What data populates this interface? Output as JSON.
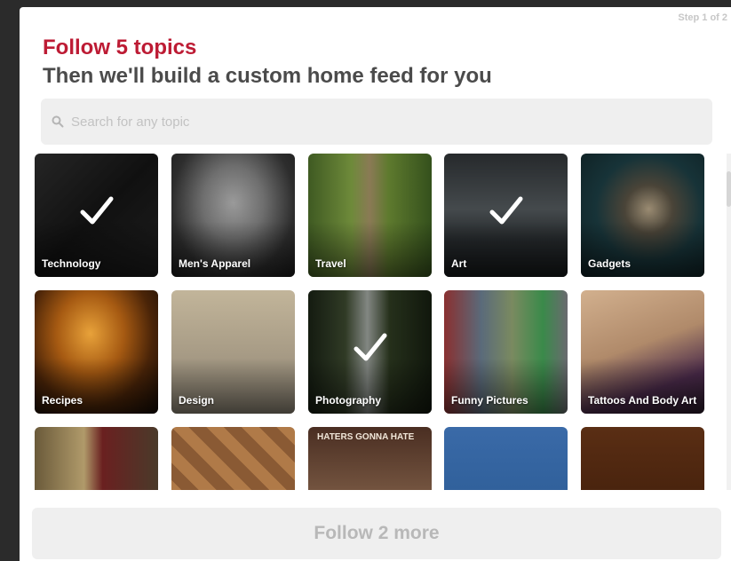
{
  "modal": {
    "step_indicator": "Step 1 of 2",
    "title": "Follow 5 topics",
    "subtitle": "Then we'll build a custom home feed for you"
  },
  "search": {
    "placeholder": "Search for any topic",
    "icon": "search-icon"
  },
  "topics": [
    {
      "label": "Technology",
      "selected": true,
      "color": "#1f1f1f"
    },
    {
      "label": "Men's Apparel",
      "selected": false,
      "color": "#5a5a5a"
    },
    {
      "label": "Travel",
      "selected": false,
      "color": "#4e6b2f"
    },
    {
      "label": "Art",
      "selected": true,
      "color": "#4a5054"
    },
    {
      "label": "Gadgets",
      "selected": false,
      "color": "#1d3a40"
    },
    {
      "label": "Recipes",
      "selected": false,
      "color": "#5a2e0e"
    },
    {
      "label": "Design",
      "selected": false,
      "color": "#a49a86"
    },
    {
      "label": "Photography",
      "selected": true,
      "color": "#2f3b2a"
    },
    {
      "label": "Funny Pictures",
      "selected": false,
      "color": "#6b6f79"
    },
    {
      "label": "Tattoos And Body Art",
      "selected": false,
      "color": "#b08a6a"
    },
    {
      "label": "",
      "selected": false,
      "color": "#6b4a2a"
    },
    {
      "label": "",
      "selected": false,
      "color": "#8a5a34"
    },
    {
      "label": "",
      "selected": false,
      "color": "#5a3a2a",
      "overlay_text": "HATERS GONNA HATE"
    },
    {
      "label": "",
      "selected": false,
      "color": "#2f5f99"
    },
    {
      "label": "",
      "selected": false,
      "color": "#4a2410"
    }
  ],
  "footer": {
    "follow_button_label": "Follow 2 more"
  },
  "colors": {
    "accent_red": "#bd1b34",
    "subtitle_gray": "#4b4b4b",
    "disabled_button": "#efefef"
  }
}
